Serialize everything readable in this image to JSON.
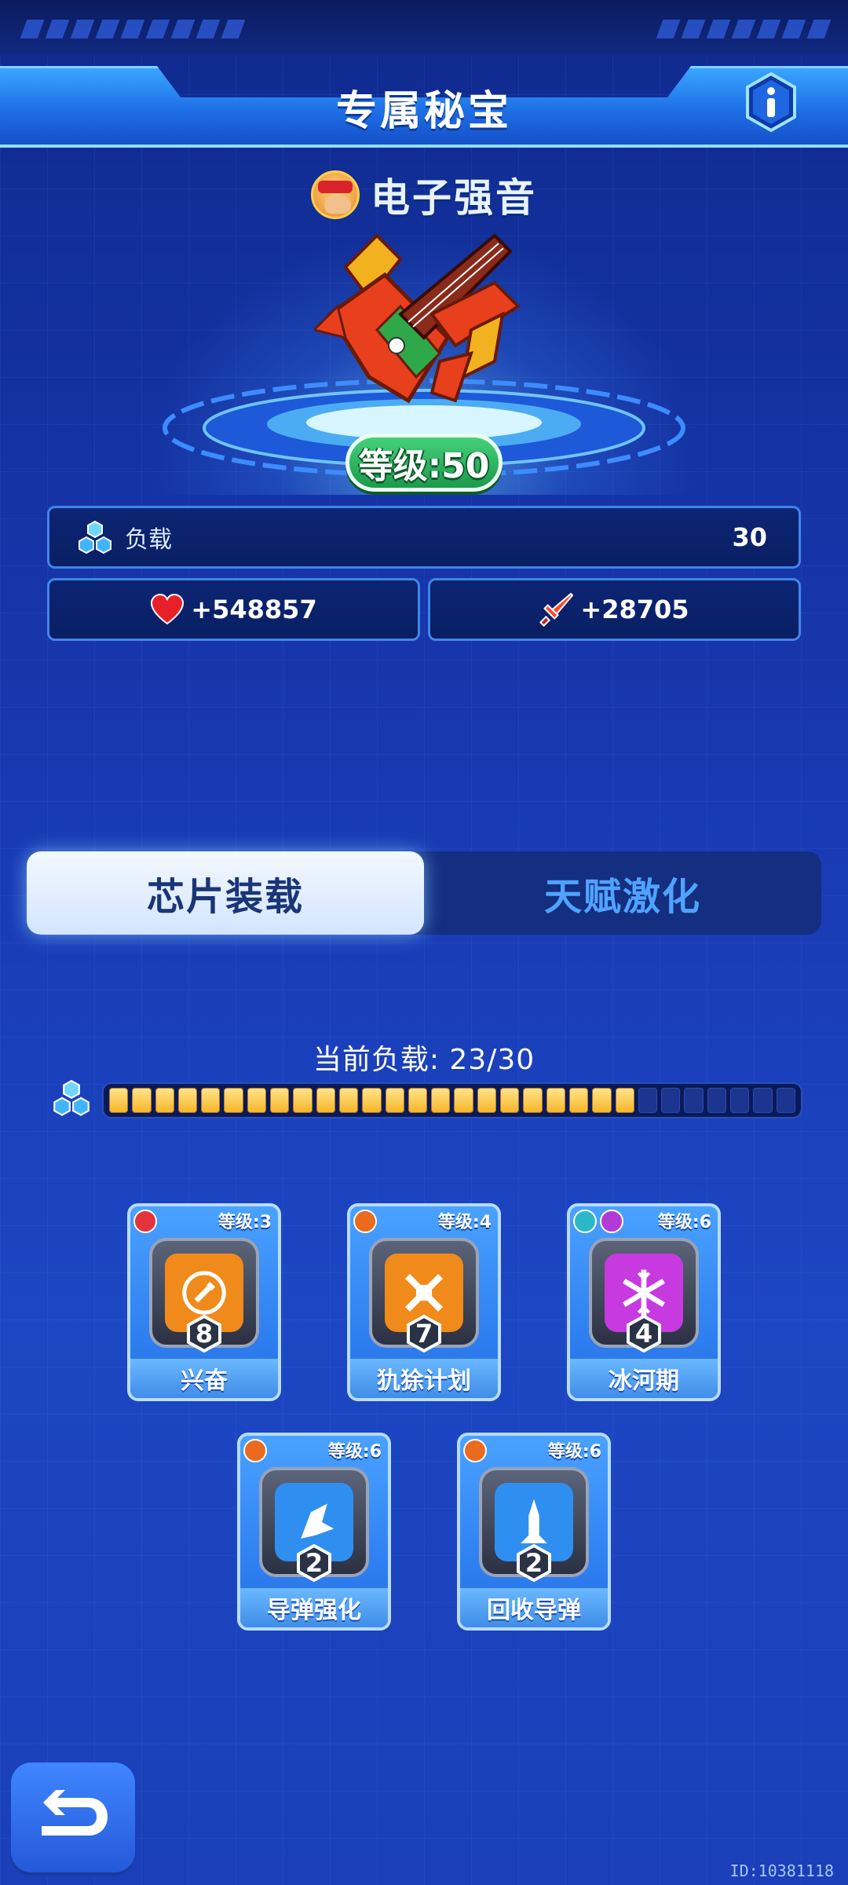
{
  "header": {
    "title": "专属秘宝",
    "info_icon": "info-icon"
  },
  "weapon": {
    "name": "电子强音",
    "level_label": "等级:50"
  },
  "stats": {
    "load_label": "负载",
    "load_value": "30",
    "hp_value": "+548857",
    "atk_value": "+28705"
  },
  "tabs": [
    {
      "label": "芯片装载",
      "active": true
    },
    {
      "label": "天赋激化",
      "active": false
    }
  ],
  "load": {
    "text": "当前负载: 23/30",
    "current": 23,
    "max": 30
  },
  "chips": [
    {
      "name": "兴奋",
      "level": "等级:3",
      "count": "8",
      "color": "#f08a1a",
      "badges": [
        "#e2343a"
      ]
    },
    {
      "name": "犰狳计划",
      "level": "等级:4",
      "count": "7",
      "color": "#f08a1a",
      "badges": [
        "#ea6a1e"
      ]
    },
    {
      "name": "冰河期",
      "level": "等级:6",
      "count": "4",
      "color": "#c63ae0",
      "badges": [
        "#2ab8c8",
        "#b23ad8"
      ]
    },
    {
      "name": "导弹强化",
      "level": "等级:6",
      "count": "2",
      "color": "#2f8ff0",
      "badges": [
        "#ea6a1e"
      ]
    },
    {
      "name": "回收导弹",
      "level": "等级:6",
      "count": "2",
      "color": "#2f8ff0",
      "badges": [
        "#ea6a1e"
      ]
    }
  ],
  "footer": {
    "id_text": "ID:10381118"
  },
  "colors": {
    "accent": "#3aa6ff",
    "load_fill": "#f7b52a",
    "level_badge": "#1b9a4c"
  }
}
